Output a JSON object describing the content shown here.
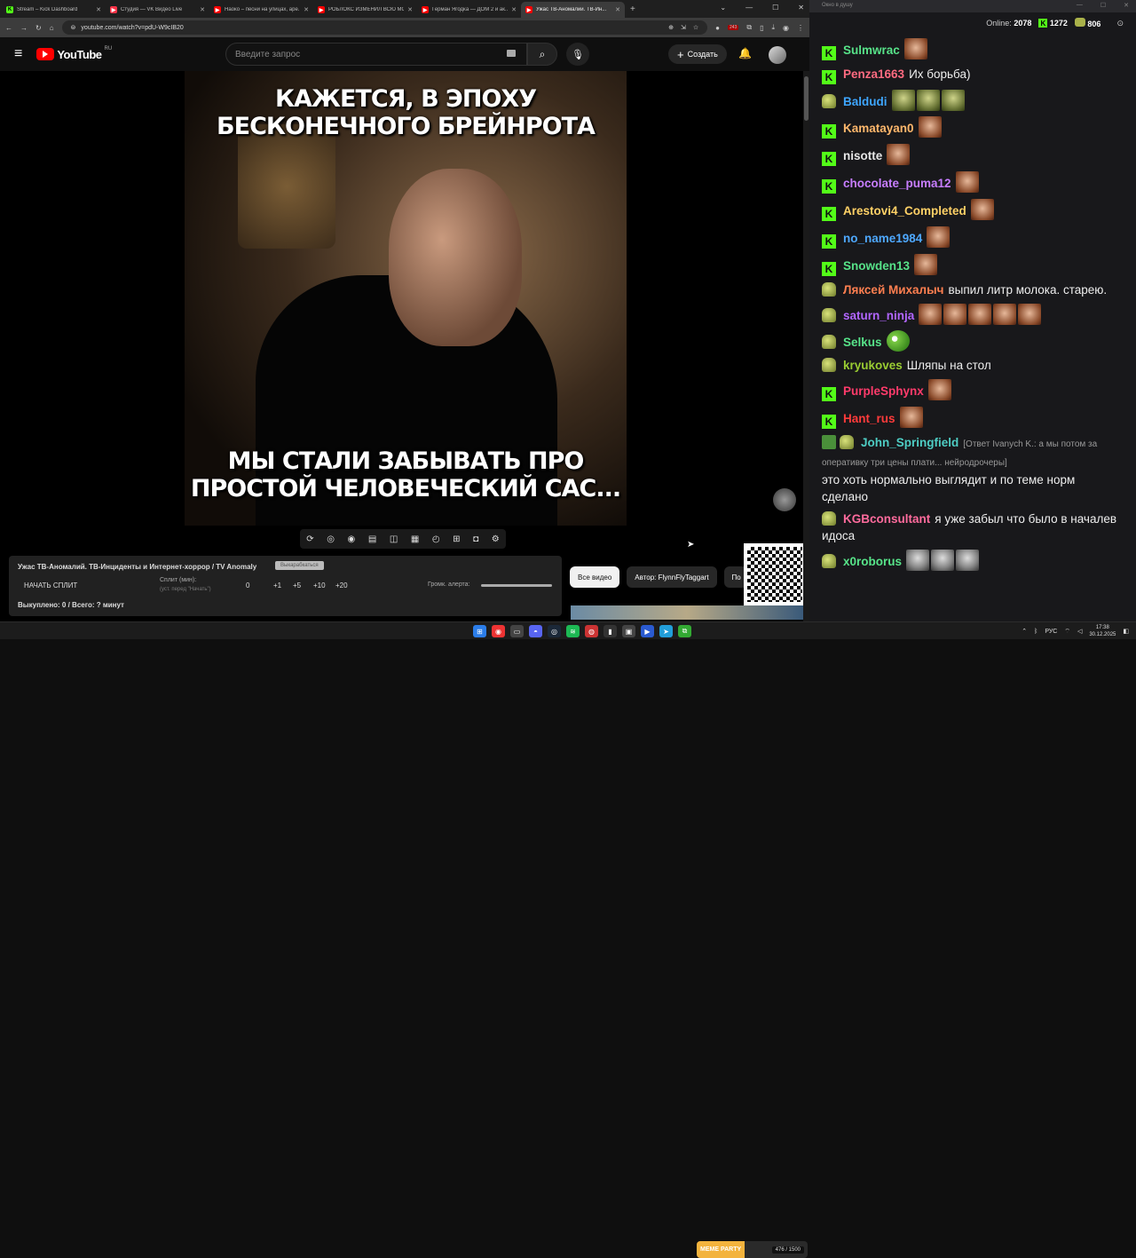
{
  "browser": {
    "tabs": [
      {
        "title": "Stream – Kick Dashboard",
        "icon": "kick-icon",
        "color": "#53fc18",
        "glyph": "K"
      },
      {
        "title": "Студия — VK Видео Live",
        "icon": "vk-video-icon",
        "color": "#ff3347",
        "glyph": "▶"
      },
      {
        "title": "Наоко – песни на улицах, арe...",
        "icon": "youtube-icon",
        "color": "#ff0000",
        "glyph": "▶"
      },
      {
        "title": "РОБЛОКС ИЗМЕНИЛ ВСЮ МОЮ...",
        "icon": "youtube-icon",
        "color": "#ff0000",
        "glyph": "▶"
      },
      {
        "title": "Герман Ягодка — ДОМ 2 и ак...",
        "icon": "youtube-icon",
        "color": "#ff0000",
        "glyph": "▶"
      },
      {
        "title": "Ужас ТВ-Аномалий. ТВ-Ин...",
        "icon": "youtube-icon",
        "color": "#ff0000",
        "glyph": "▶"
      }
    ],
    "url": "youtube.com/watch?v=pdU-W9cIB20",
    "badge_count": "243"
  },
  "youtube": {
    "logo_text": "YouTube",
    "logo_region": "RU",
    "search_placeholder": "Введите запрос",
    "create_label": "Создать",
    "meme": {
      "top_text": "КАЖЕТСЯ, В ЭПОХУ\nБЕСКОНЕЧНОГО БРЕЙНРОТА",
      "bottom_text": "МЫ СТАЛИ ЗАБЫВАТЬ ПРО\nПРОСТОЙ ЧЕЛОВЕЧЕСКИЙ САС..."
    },
    "chips": [
      "Все видео",
      "Автор: FlynnFlyTaggart",
      "По"
    ]
  },
  "extension": {
    "title": "Ужас ТВ-Аномалий. ТВ-Инциденты и Интернет-хоррор / TV Anomaly",
    "tag": "Выкарабкаться",
    "split_button": "НАЧАТЬ СПЛИТ",
    "split_label": "Сплит (мин):",
    "split_sub": "(уст. перед \"Начать\")",
    "split_value": "0",
    "increments": [
      "+1",
      "+5",
      "+10",
      "+20"
    ],
    "volume_label": "Громк. алерта:",
    "volume": 1.0,
    "footer": "Выкуплено: 0 / Всего: ? минут"
  },
  "chat": {
    "window_title": "Окно в душу",
    "online_label": "Online:",
    "online": "2078",
    "kick_count": "1272",
    "pepe_count": "806",
    "messages": [
      {
        "badge": "k",
        "name": "Sulmwrac",
        "color": "#57e389",
        "text": "",
        "emotes": [
          "em"
        ]
      },
      {
        "badge": "k",
        "name": "Penza1663",
        "color": "#ff6b81",
        "text": "Их борьба)",
        "emotes": []
      },
      {
        "badge": "p",
        "name": "Baldudi",
        "color": "#3ea6ff",
        "text": "",
        "emotes": [
          "gop",
          "gop",
          "gop"
        ]
      },
      {
        "badge": "k",
        "name": "Kamatayan0",
        "color": "#ffb86c",
        "text": "",
        "emotes": [
          "em"
        ]
      },
      {
        "badge": "k",
        "name": "nisotte",
        "color": "#e6e6e6",
        "text": "",
        "emotes": [
          "em"
        ]
      },
      {
        "badge": "k",
        "name": "chocolate_puma12",
        "color": "#c77dff",
        "text": "",
        "emotes": [
          "em"
        ]
      },
      {
        "badge": "k",
        "name": "Arestovi4_Completed",
        "color": "#ffd166",
        "text": "",
        "emotes": [
          "em"
        ]
      },
      {
        "badge": "k",
        "name": "no_name1984",
        "color": "#4ea8ff",
        "text": "",
        "emotes": [
          "em"
        ]
      },
      {
        "badge": "k",
        "name": "Snowden13",
        "color": "#57e389",
        "text": "",
        "emotes": [
          "em"
        ]
      },
      {
        "badge": "p",
        "name": "Ляксей Михалыч",
        "color": "#ff7f50",
        "text": "выпил литр молока. старею.",
        "emotes": []
      },
      {
        "badge": "p",
        "name": "saturn_ninja",
        "color": "#b266ff",
        "text": "",
        "emotes": [
          "em",
          "em",
          "em",
          "em",
          "em"
        ]
      },
      {
        "badge": "p",
        "name": "Selkus",
        "color": "#57e389",
        "text": "",
        "emotes": [
          "frog"
        ]
      },
      {
        "badge": "p",
        "name": "kryukoves",
        "color": "#9acd32",
        "text": "Шляпы на стол",
        "emotes": []
      },
      {
        "badge": "k",
        "name": "PurpleSphynx",
        "color": "#ff3b6b",
        "text": "",
        "emotes": [
          "em"
        ]
      },
      {
        "badge": "k",
        "name": "Hant_rus",
        "color": "#ff3b3b",
        "text": "",
        "emotes": [
          "em"
        ]
      },
      {
        "badge": "pen",
        "name": "John_Springfield",
        "color": "#4ecdc4",
        "reply": "[Ответ Ivanych K.: а мы потом за оперативку три цены плати... нейродрочеры]",
        "text": "это хоть нормально выглядит и по теме норм сделано",
        "emotes": []
      },
      {
        "badge": "p",
        "name": "KGBconsultant",
        "color": "#ff6b9d",
        "text": "я уже забыл что было в началев идоса",
        "emotes": []
      },
      {
        "badge": "p",
        "name": "x0roborus",
        "color": "#57e389",
        "text": "",
        "emotes": [
          "wolf",
          "wolf",
          "wolf"
        ]
      }
    ]
  },
  "taskbar": {
    "widget_label": "MEME PARTY",
    "widget_count": "476 / 1500",
    "lang": "РУС",
    "time": "17:38",
    "date": "30.12.2025"
  }
}
